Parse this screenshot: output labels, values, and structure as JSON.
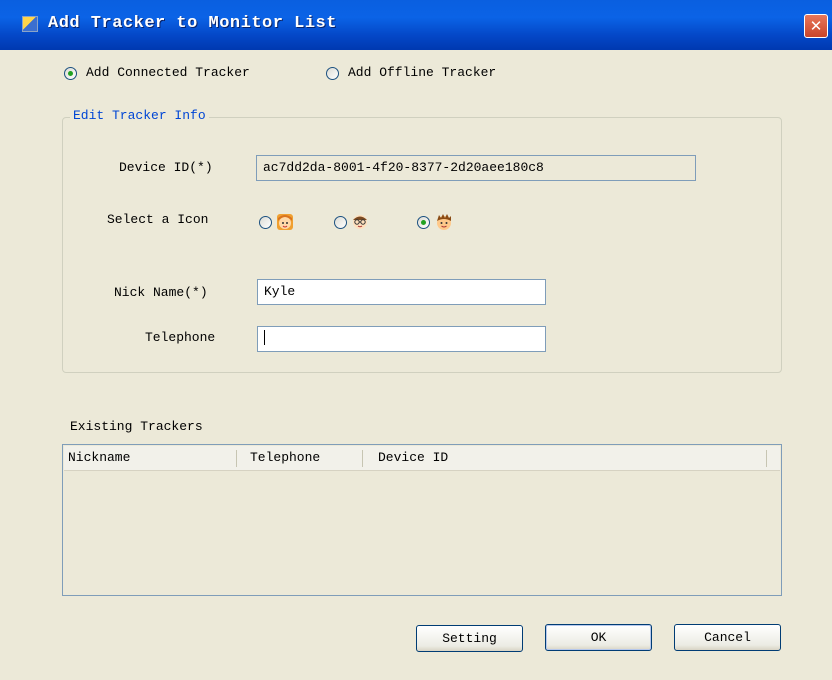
{
  "window": {
    "title": "Add Tracker to Monitor List",
    "close_glyph": "✕"
  },
  "mode": {
    "options": [
      {
        "label": "Add Connected Tracker",
        "selected": true
      },
      {
        "label": "Add Offline Tracker",
        "selected": false
      }
    ]
  },
  "edit_group": {
    "title": "Edit Tracker Info",
    "device_id_label": "Device ID(*)",
    "device_id_value": "ac7dd2da-8001-4f20-8377-2d20aee180c8",
    "icon_label": "Select a Icon",
    "icons": [
      {
        "name": "girl-face-icon",
        "selected": false
      },
      {
        "name": "glasses-face-icon",
        "selected": false
      },
      {
        "name": "boy-face-icon",
        "selected": true
      }
    ],
    "nickname_label": "Nick Name(*)",
    "nickname_value": "Kyle",
    "telephone_label": "Telephone",
    "telephone_value": ""
  },
  "existing": {
    "title": "Existing Trackers",
    "columns": [
      "Nickname",
      "Telephone",
      "Device ID"
    ],
    "rows": []
  },
  "buttons": {
    "setting": "Setting",
    "ok": "OK",
    "cancel": "Cancel"
  }
}
